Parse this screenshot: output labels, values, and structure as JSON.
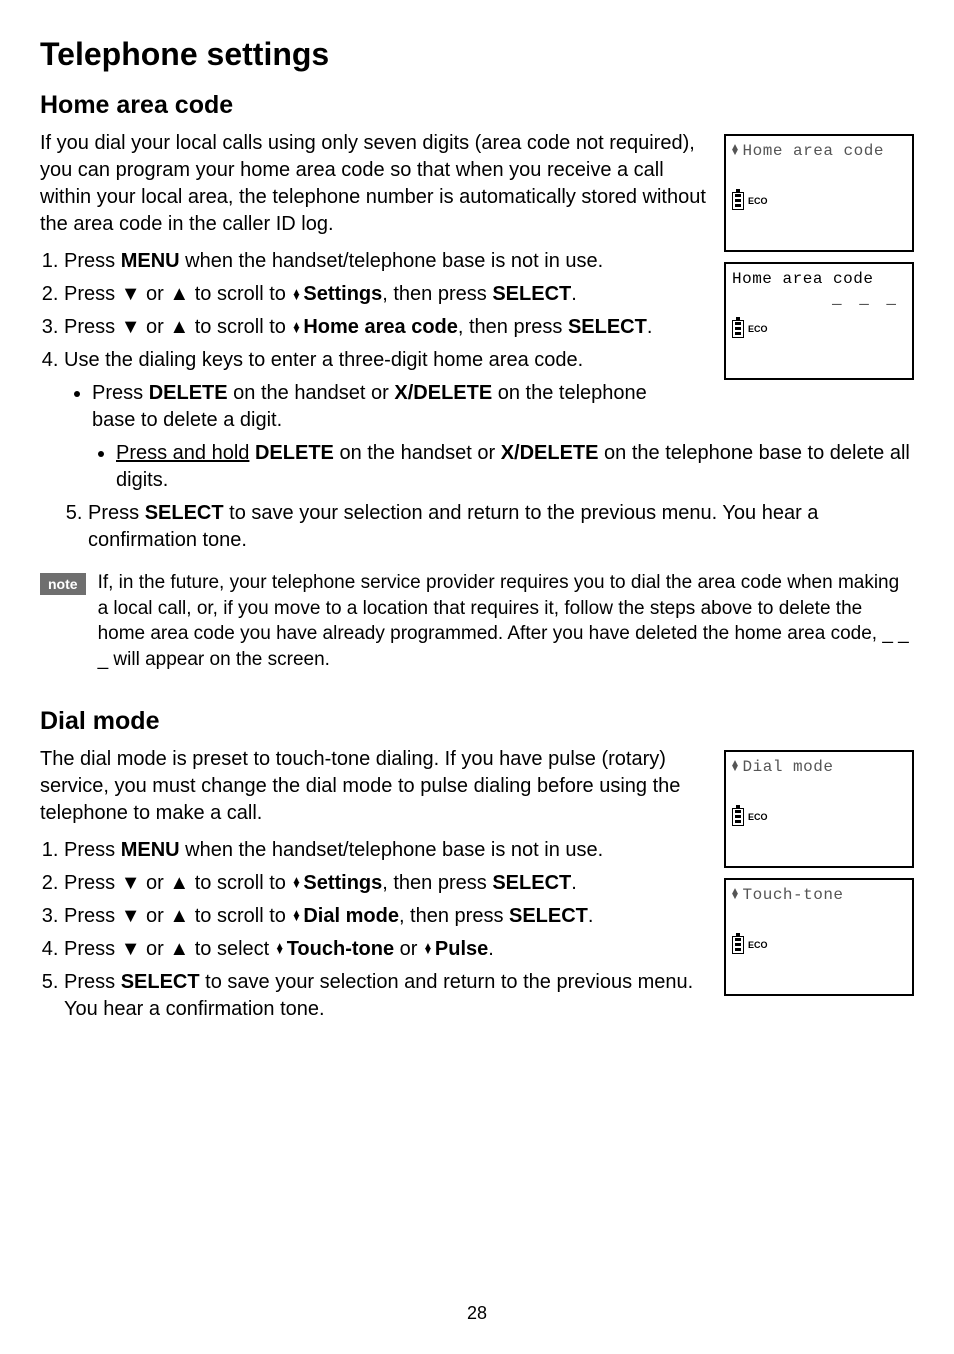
{
  "page_title": "Telephone settings",
  "page_number": "28",
  "home_area": {
    "heading": "Home area code",
    "intro": "If you dial your local calls using only seven digits (area code not required), you can program your home area code so that when you receive a call within your local area, the telephone number is automatically stored without the area code in the caller ID log.",
    "step1_a": "Press ",
    "step1_b": "MENU",
    "step1_c": " when the handset/telephone base is not in use.",
    "step2_a": "Press ",
    "step2_b": " or ",
    "step2_c": " to scroll to ",
    "step2_d": "Settings",
    "step2_e": ", then press ",
    "step2_f": "SELECT",
    "step2_g": ".",
    "step3_a": "Press ",
    "step3_b": " or ",
    "step3_c": " to scroll to ",
    "step3_d": "Home area code",
    "step3_e": ", then press ",
    "step3_f": "SELECT",
    "step3_g": ".",
    "step4": "Use the dialing keys to enter a three-digit home area code.",
    "bullet1_a": "Press ",
    "bullet1_b": "DELETE",
    "bullet1_c": " on the handset or ",
    "bullet1_d": "X/DELETE",
    "bullet1_e": " on the telephone base to delete a digit.",
    "bullet2_a": "Press and hold",
    "bullet2_b": " ",
    "bullet2_c": "DELETE",
    "bullet2_d": " on the handset or ",
    "bullet2_e": "X/DELETE",
    "bullet2_f": " on the telephone base to delete all digits.",
    "step5_a": "Press ",
    "step5_b": "SELECT",
    "step5_c": " to save your selection and return to the previous menu. You hear a confirmation tone.",
    "note_label": "note",
    "note_text": "If, in the future, your telephone service provider requires you to dial the area code when making a local call, or, if you move to a location that requires it, follow the steps above to delete the home area code you have already programmed. After you have deleted the home area code, _ _ _ will appear on the screen.",
    "screen1_line": "Home area code",
    "screen2_line1": "Home area code",
    "screen2_line2": "_ _ _",
    "eco": "ECO"
  },
  "dial_mode": {
    "heading": "Dial mode",
    "intro": "The dial mode is preset to touch-tone dialing. If you have pulse (rotary) service, you must change the dial mode to pulse dialing before using the telephone to make a call.",
    "step1_a": "Press ",
    "step1_b": "MENU",
    "step1_c": " when the handset/telephone base is not in use.",
    "step2_a": "Press ",
    "step2_b": " or ",
    "step2_c": " to scroll to ",
    "step2_d": "Settings",
    "step2_e": ", then press ",
    "step2_f": "SELECT",
    "step2_g": ".",
    "step3_a": "Press ",
    "step3_b": " or ",
    "step3_c": " to scroll to ",
    "step3_d": "Dial mode",
    "step3_e": ", then press ",
    "step3_f": "SELECT",
    "step3_g": ".",
    "step4_a": "Press ",
    "step4_b": " or ",
    "step4_c": " to select ",
    "step4_d": "Touch-tone",
    "step4_e": " or ",
    "step4_f": "Pulse",
    "step4_g": ".",
    "step5_a": "Press ",
    "step5_b": "SELECT",
    "step5_c": " to save your selection and return to the previous menu. You hear a confirmation tone.",
    "screen1_line": "Dial mode",
    "screen2_line": "Touch-tone",
    "eco": "ECO"
  }
}
